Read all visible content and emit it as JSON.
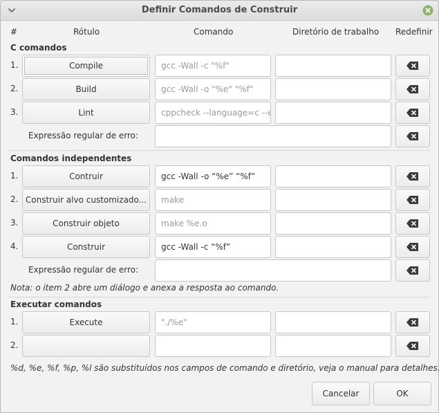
{
  "window": {
    "title": "Definir Comandos de Construir"
  },
  "headers": {
    "num": "#",
    "label": "Rótulo",
    "command": "Comando",
    "workdir": "Diretório de trabalho",
    "reset": "Redefinir"
  },
  "c_section": {
    "title": "C comandos",
    "rows": [
      {
        "num": "1.",
        "label": "Compile",
        "command": "gcc -Wall -c \"%f\"",
        "workdir": ""
      },
      {
        "num": "2.",
        "label": "Build",
        "command": "gcc -Wall -o \"%e\" \"%f\"",
        "workdir": ""
      },
      {
        "num": "3.",
        "label": "Lint",
        "command": "cppcheck --language=c --er",
        "workdir": ""
      }
    ],
    "regex_label": "Expressão regular de erro:",
    "regex_value": ""
  },
  "indep_section": {
    "title": "Comandos independentes",
    "rows": [
      {
        "num": "1.",
        "label": "Contruir",
        "command": "gcc -Wall -o “%e” “%f”",
        "workdir": ""
      },
      {
        "num": "2.",
        "label": "Construir alvo customizado...",
        "command": "make",
        "workdir": ""
      },
      {
        "num": "3.",
        "label": "Construir objeto",
        "command": "make %e.o",
        "workdir": ""
      },
      {
        "num": "4.",
        "label": "Construir",
        "command": "gcc -Wall -c “%f”",
        "workdir": ""
      }
    ],
    "regex_label": "Expressão regular de erro:",
    "regex_value": "",
    "note": "Nota: o item 2 abre um diálogo e anexa a resposta ao comando."
  },
  "exec_section": {
    "title": "Executar comandos",
    "rows": [
      {
        "num": "1.",
        "label": "Execute",
        "command": "\"./%e\"",
        "workdir": ""
      },
      {
        "num": "2.",
        "label": "",
        "command": "",
        "workdir": ""
      }
    ]
  },
  "footer_note": "%d, %e, %f, %p, %l são substituídos nos campos de comando e diretório, veja o manual para detalhes.",
  "buttons": {
    "cancel": "Cancelar",
    "ok": "OK"
  },
  "icons": {
    "reset": "clear-backspace-icon",
    "close": "close-icon",
    "menu": "chevron-down-icon"
  },
  "colors": {
    "window_bg": "#f2f2f2",
    "close_green": "#8fb170"
  }
}
